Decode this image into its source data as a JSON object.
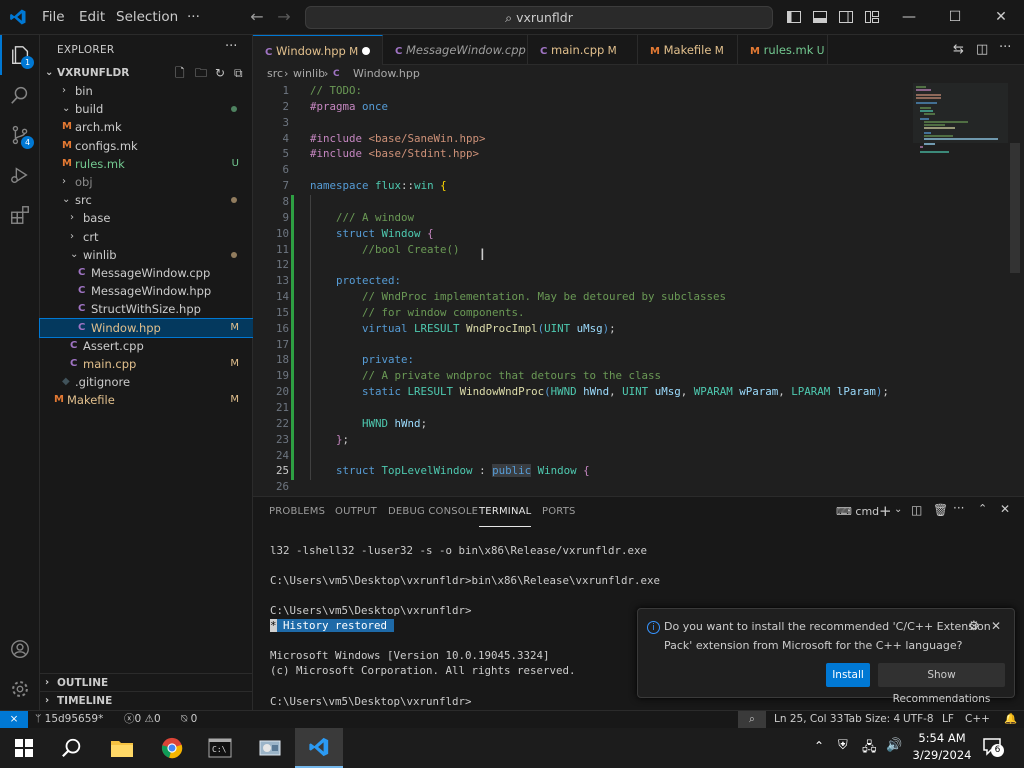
{
  "titlebar": {
    "menus": [
      "File",
      "Edit",
      "Selection"
    ],
    "more": "···",
    "search_text": "vxrunfldr",
    "colors": {
      "vscode_blue": "#0078d4",
      "accent_green": "#2ea043"
    }
  },
  "activity_bar": {
    "items": [
      "explorer-icon",
      "search-icon",
      "source-control-icon",
      "run-debug-icon",
      "extensions-icon"
    ],
    "explorer_badge": "1",
    "scm_badge": "4",
    "bottom": [
      "account-icon",
      "settings-gear-icon"
    ]
  },
  "sidebar": {
    "title": "EXPLORER",
    "more": "···",
    "root": "VXRUNFLDR",
    "tree": [
      {
        "label": "bin",
        "type": "folder",
        "state": "collapsed",
        "depth": 1,
        "status": ""
      },
      {
        "label": "build",
        "type": "folder",
        "state": "expanded",
        "depth": 1,
        "status": "dot",
        "color": "#73c991"
      },
      {
        "label": "arch.mk",
        "type": "makefile",
        "depth": 1,
        "status": ""
      },
      {
        "label": "configs.mk",
        "type": "makefile",
        "depth": 1,
        "status": ""
      },
      {
        "label": "rules.mk",
        "type": "makefile",
        "depth": 1,
        "status": "U",
        "color": "#73c991"
      },
      {
        "label": "obj",
        "type": "folder",
        "state": "collapsed",
        "depth": 1,
        "status": ""
      },
      {
        "label": "src",
        "type": "folder",
        "state": "expanded",
        "depth": 1,
        "status": "dot",
        "color": "#e2c08d"
      },
      {
        "label": "base",
        "type": "folder",
        "state": "collapsed",
        "depth": 2,
        "status": ""
      },
      {
        "label": "crt",
        "type": "folder",
        "state": "collapsed",
        "depth": 2,
        "status": ""
      },
      {
        "label": "winlib",
        "type": "folder",
        "state": "expanded",
        "depth": 2,
        "status": "dot",
        "color": "#e2c08d"
      },
      {
        "label": "MessageWindow.cpp",
        "type": "cpp",
        "depth": 3,
        "status": ""
      },
      {
        "label": "MessageWindow.hpp",
        "type": "cpp",
        "depth": 3,
        "status": ""
      },
      {
        "label": "StructWithSize.hpp",
        "type": "cpp",
        "depth": 3,
        "status": ""
      },
      {
        "label": "Window.hpp",
        "type": "cpp",
        "depth": 3,
        "status": "M",
        "color": "#e2c08d",
        "selected": true
      },
      {
        "label": "Assert.cpp",
        "type": "cpp",
        "depth": 2,
        "status": ""
      },
      {
        "label": "main.cpp",
        "type": "cpp",
        "depth": 2,
        "status": "M",
        "color": "#e2c08d"
      },
      {
        "label": ".gitignore",
        "type": "git",
        "depth": 1,
        "status": ""
      },
      {
        "label": "Makefile",
        "type": "makefile",
        "depth": 0,
        "status": "M",
        "color": "#e2c08d"
      }
    ],
    "outline": "OUTLINE",
    "timeline": "TIMELINE"
  },
  "tabs": [
    {
      "label": "Window.hpp",
      "flag": "M",
      "dirty": true,
      "active": true,
      "type": "cpp"
    },
    {
      "label": "MessageWindow.cpp",
      "flag": "",
      "italic": true,
      "type": "cpp"
    },
    {
      "label": "main.cpp",
      "flag": "M",
      "type": "cpp"
    },
    {
      "label": "Makefile",
      "flag": "M",
      "type": "makefile"
    },
    {
      "label": "rules.mk",
      "flag": "U",
      "type": "makefile"
    }
  ],
  "breadcrumb": [
    "src",
    "winlib",
    "Window.hpp"
  ],
  "editor": {
    "current_line": 25,
    "lines": [
      {
        "n": 1,
        "html": "<span class='c'>// TODO:</span>"
      },
      {
        "n": 2,
        "html": "<span class='kc'>#pragma</span> <span class='k'>once</span>"
      },
      {
        "n": 3,
        "html": ""
      },
      {
        "n": 4,
        "html": "<span class='kc'>#include</span> <span class='s'>&lt;base/SaneWin.hpp&gt;</span>"
      },
      {
        "n": 5,
        "html": "<span class='kc'>#include</span> <span class='s'>&lt;base/Stdint.hpp&gt;</span>"
      },
      {
        "n": 6,
        "html": ""
      },
      {
        "n": 7,
        "html": "<span class='k'>namespace</span> <span class='t'>flux</span>::<span class='t'>win</span> <span class='p'>{</span>"
      },
      {
        "n": 8,
        "html": ""
      },
      {
        "n": 9,
        "html": "    <span class='c'>/// A window</span>"
      },
      {
        "n": 10,
        "html": "    <span class='k'>struct</span> <span class='t'>Window</span> <span class='kc'>{</span>"
      },
      {
        "n": 11,
        "html": "        <span class='c'>//bool Create()</span>"
      },
      {
        "n": 12,
        "html": ""
      },
      {
        "n": 13,
        "html": "    <span class='k'>protected:</span>"
      },
      {
        "n": 14,
        "html": "        <span class='c'>// WndProc implementation. May be detoured by subclasses</span>"
      },
      {
        "n": 15,
        "html": "        <span class='c'>// for window components.</span>"
      },
      {
        "n": 16,
        "html": "        <span class='k'>virtual</span> <span class='t'>LRESULT</span> <span class='f'>WndProcImpl</span><span class='k'>(</span><span class='t'>UINT</span> <span class='v'>uMsg</span><span class='k'>)</span>;"
      },
      {
        "n": 17,
        "html": ""
      },
      {
        "n": 18,
        "html": "        <span class='k'>private:</span>"
      },
      {
        "n": 19,
        "html": "        <span class='c'>// A private wndproc that detours to the class</span>"
      },
      {
        "n": 20,
        "html": "        <span class='k'>static</span> <span class='t'>LRESULT</span> <span class='f'>WindowWndProc</span><span class='k'>(</span><span class='t'>HWND</span> <span class='v'>hWnd</span>, <span class='t'>UINT</span> <span class='v'>uMsg</span>, <span class='t'>WPARAM</span> <span class='v'>wParam</span>, <span class='t'>LPARAM</span> <span class='v'>lParam</span><span class='k'>)</span>;"
      },
      {
        "n": 21,
        "html": ""
      },
      {
        "n": 22,
        "html": "        <span class='t'>HWND</span> <span class='v'>hWnd</span>;"
      },
      {
        "n": 23,
        "html": "    <span class='kc'>}</span>;"
      },
      {
        "n": 24,
        "html": ""
      },
      {
        "n": 25,
        "html": "    <span class='k'>struct</span> <span class='t'>TopLevelWindow</span> : <span class='k' style='background:#3a3d41'>public</span> <span class='t'>Window</span> <span class='kc'>{</span>"
      },
      {
        "n": 26,
        "html": ""
      }
    ]
  },
  "panel": {
    "tabs": [
      "PROBLEMS",
      "OUTPUT",
      "DEBUG CONSOLE",
      "TERMINAL",
      "PORTS"
    ],
    "active_tab": "TERMINAL",
    "terminal_kind": "cmd",
    "terminal_lines": [
      "l32 -lshell32 -luser32 -s -o bin\\x86\\Release/vxrunfldr.exe",
      "",
      "C:\\Users\\vm5\\Desktop\\vxrunfldr>bin\\x86\\Release\\vxrunfldr.exe",
      "",
      "C:\\Users\\vm5\\Desktop\\vxrunfldr>",
      "",
      "",
      "Microsoft Windows [Version 10.0.19045.3324]",
      "(c) Microsoft Corporation. All rights reserved.",
      "",
      "C:\\Users\\vm5\\Desktop\\vxrunfldr>"
    ],
    "history_star": "*",
    "history_label": "History restored"
  },
  "notification": {
    "line1": "Do you want to install the recommended 'C/C++ Extension",
    "line2": "Pack' extension from Microsoft for the C++ language?",
    "install": "Install",
    "show": "Show Recommendations"
  },
  "statusbar": {
    "remote": "⨯",
    "branch": "15d95659*",
    "errors": "0",
    "warnings": "0",
    "ports": "0",
    "position": "Ln 25, Col 33",
    "tabsize": "Tab Size: 4",
    "encoding": "UTF-8",
    "eol": "LF",
    "language": "C++"
  },
  "taskbar": {
    "time": "5:54 AM",
    "date": "3/29/2024",
    "notifications": "6"
  }
}
